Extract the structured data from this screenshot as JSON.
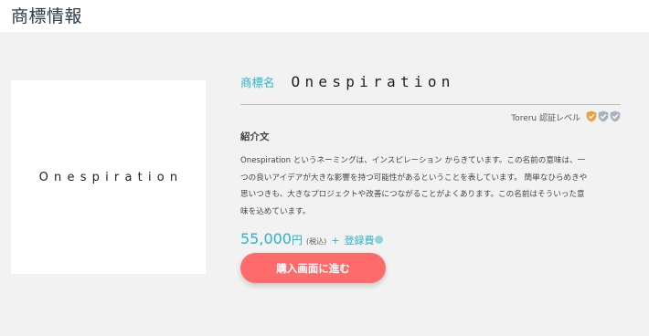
{
  "page": {
    "title": "商標情報"
  },
  "logo": {
    "text": "Onespiration"
  },
  "trademark": {
    "name_label": "商標名",
    "name_value": "Onespiration"
  },
  "certification": {
    "label": "Toreru 認証レベル",
    "level": 1,
    "max_level": 3,
    "active_color": "#e8a33d",
    "inactive_color": "#a9b3bf"
  },
  "intro": {
    "heading": "紹介文",
    "lines": [
      "Onespiration というネーミングは、インスピレーション からきています。この名前の意味は、一",
      "つの良いアイデアが大きな影響を持つ可能性があるということを表しています。 簡単なひらめきや",
      "思いつきも、大きなプロジェクトや改善につながることがよくあります。この名前はそういった意",
      "味を込めています。"
    ]
  },
  "price": {
    "amount": "55,000",
    "unit": "円",
    "tax_note": "(税込)",
    "plus": "+",
    "registration_fee_label": "登録費"
  },
  "buy_button": {
    "label": "購入画面に進む"
  },
  "colors": {
    "accent": "#2bb3c8",
    "button": "#ff6b6b",
    "panel_bg": "#f2f2f2"
  },
  "icons": {
    "shield": "shield-check-icon",
    "info": "info-icon"
  }
}
